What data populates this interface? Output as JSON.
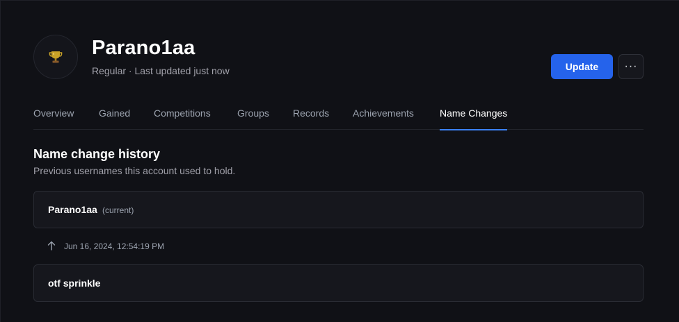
{
  "profile": {
    "name": "Parano1aa",
    "subtitle": "Regular · Last updated just now",
    "avatar_icon": "trophy-icon"
  },
  "actions": {
    "update_label": "Update",
    "more_label": "···"
  },
  "tabs": [
    {
      "label": "Overview",
      "active": false
    },
    {
      "label": "Gained",
      "active": false
    },
    {
      "label": "Competitions",
      "active": false
    },
    {
      "label": "Groups",
      "active": false
    },
    {
      "label": "Records",
      "active": false
    },
    {
      "label": "Achievements",
      "active": false
    },
    {
      "label": "Name Changes",
      "active": true
    }
  ],
  "section": {
    "title": "Name change history",
    "description": "Previous usernames this account used to hold."
  },
  "history": {
    "current": {
      "name": "Parano1aa",
      "tag": "(current)"
    },
    "change": {
      "date": "Jun 16, 2024, 12:54:19 PM",
      "icon": "arrow-up-icon"
    },
    "previous": {
      "name": "otf sprinkle"
    }
  },
  "colors": {
    "accent": "#2563eb",
    "background": "#101116",
    "card": "#16171d"
  }
}
